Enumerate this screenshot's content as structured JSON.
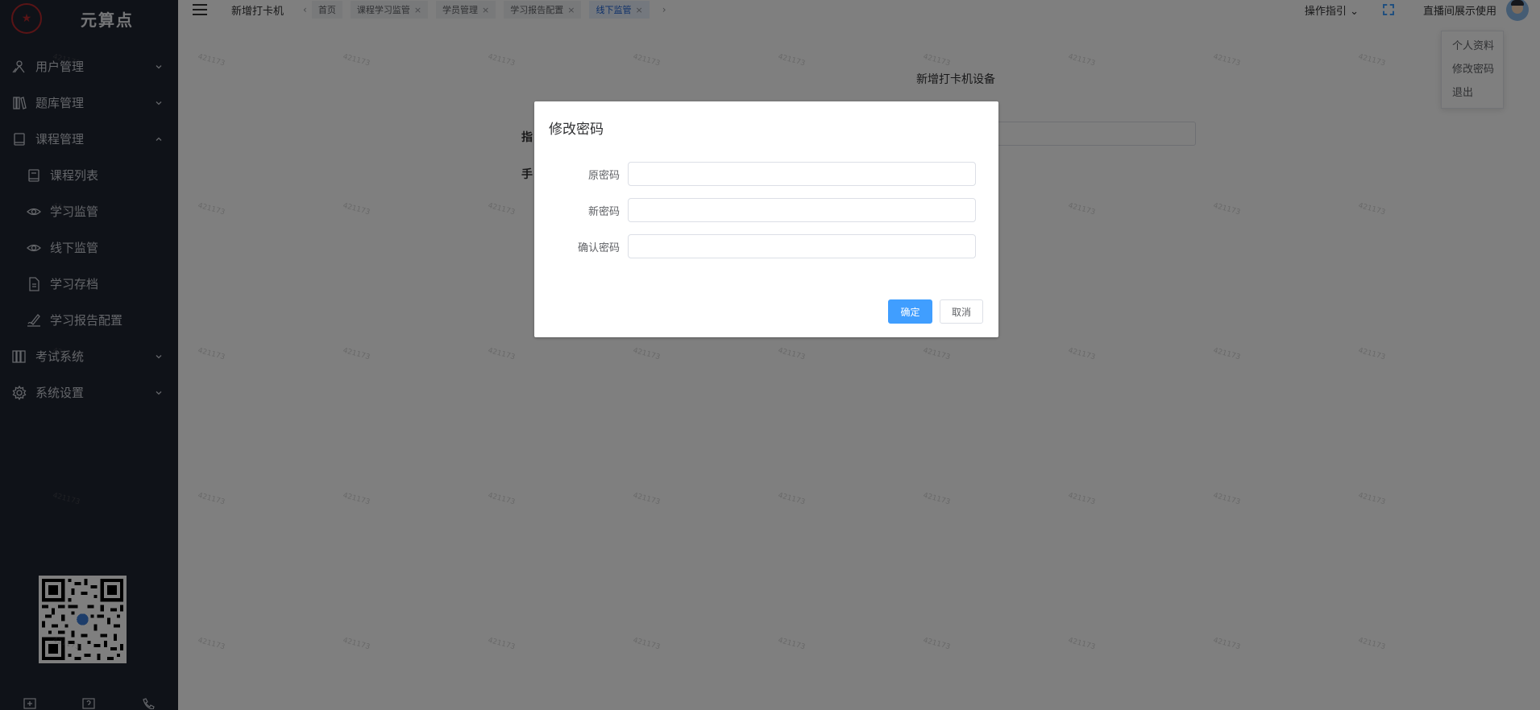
{
  "app": {
    "logo_text": "元算点",
    "logo_emblem": "★"
  },
  "sidebar": {
    "items": [
      {
        "label": "用户管理",
        "icon": "users-icon",
        "expanded": false
      },
      {
        "label": "题库管理",
        "icon": "library-icon",
        "expanded": false
      },
      {
        "label": "课程管理",
        "icon": "book-icon",
        "expanded": true
      },
      {
        "label": "考试系统",
        "icon": "columns-icon",
        "expanded": false
      },
      {
        "label": "系统设置",
        "icon": "gear-icon",
        "expanded": false
      }
    ],
    "course_submenu": [
      {
        "label": "课程列表",
        "icon": "course-list-icon"
      },
      {
        "label": "学习监管",
        "icon": "eye-icon"
      },
      {
        "label": "线下监管",
        "icon": "eye-icon"
      },
      {
        "label": "学习存档",
        "icon": "document-icon"
      },
      {
        "label": "学习报告配置",
        "icon": "signature-icon"
      }
    ],
    "footer_icons": [
      "export-icon",
      "help-icon",
      "phone-icon"
    ]
  },
  "topbar": {
    "breadcrumb": "新增打卡机",
    "tabs": [
      {
        "label": "首页",
        "closable": false,
        "active": false
      },
      {
        "label": "课程学习监管",
        "closable": true,
        "active": false
      },
      {
        "label": "学员管理",
        "closable": true,
        "active": false
      },
      {
        "label": "学习报告配置",
        "closable": true,
        "active": false
      },
      {
        "label": "线下监管",
        "closable": true,
        "active": true
      }
    ],
    "guide_label": "操作指引",
    "username": "直播间展示使用",
    "tab_close_glyph": "×",
    "tab_prev_glyph": "‹",
    "tab_next_glyph": "›",
    "guide_caret_glyph": "⌄"
  },
  "user_dropdown": {
    "items": [
      "个人资料",
      "修改密码",
      "退出"
    ]
  },
  "page": {
    "title": "新增打卡机设备",
    "label_1": "指",
    "label_2": "手"
  },
  "watermark": "421173",
  "dialog": {
    "title": "修改密码",
    "fields": [
      {
        "label": "原密码",
        "value": ""
      },
      {
        "label": "新密码",
        "value": ""
      },
      {
        "label": "确认密码",
        "value": ""
      }
    ],
    "confirm_label": "确定",
    "cancel_label": "取消"
  },
  "colors": {
    "sidebar_bg": "#1f2430",
    "primary": "#409eff",
    "active_tab": "#1f62d3",
    "logo_red": "#b3282d"
  }
}
